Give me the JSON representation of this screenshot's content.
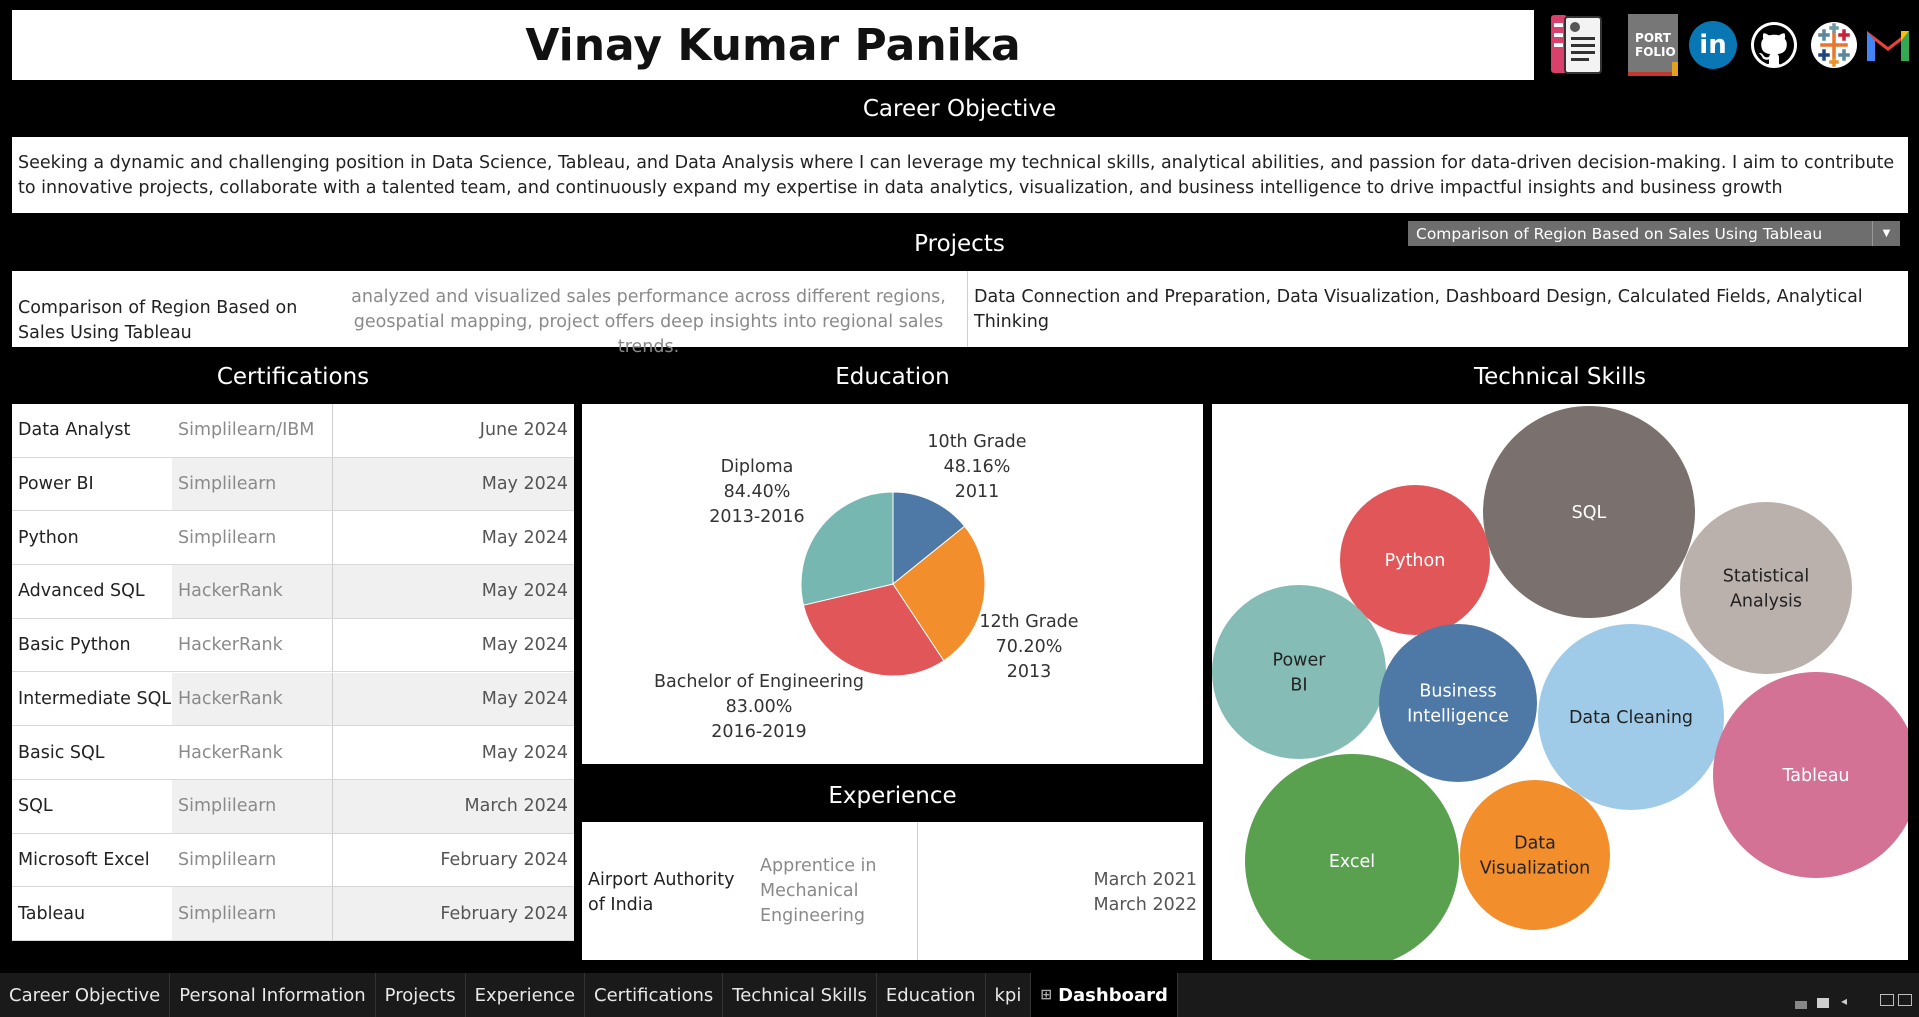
{
  "header": {
    "name": "Vinay Kumar Panika",
    "icons": [
      {
        "name": "resume-icon"
      },
      {
        "name": "portfolio-icon",
        "text": "PORT FOLIO"
      },
      {
        "name": "linkedin-icon",
        "text": "in"
      },
      {
        "name": "github-icon"
      },
      {
        "name": "tableau-icon"
      },
      {
        "name": "gmail-icon"
      }
    ]
  },
  "career": {
    "title": "Career Objective",
    "text": "Seeking a dynamic and challenging position in Data Science, Tableau, and Data Analysis where I can leverage my technical skills, analytical abilities, and passion for data-driven decision-making. I aim to contribute to innovative projects, collaborate with a talented team, and continuously expand my expertise in data analytics, visualization, and business intelligence to drive impactful insights and business growth"
  },
  "projects": {
    "title": "Projects",
    "dropdown_value": "Comparison of Region Based on Sales Using Tableau",
    "name": "Comparison of Region Based on Sales Using Tableau",
    "description": "analyzed and visualized sales performance across different regions, geospatial mapping, project offers deep insights into regional sales trends.",
    "skills": "Data Connection and Preparation, Data Visualization, Dashboard Design, Calculated Fields,  Analytical Thinking"
  },
  "certifications": {
    "title": "Certifications",
    "rows": [
      {
        "name": "Data Analyst",
        "issuer": "Simplilearn/IBM",
        "date": "June 2024"
      },
      {
        "name": "Power BI",
        "issuer": "Simplilearn",
        "date": "May 2024"
      },
      {
        "name": "Python",
        "issuer": "Simplilearn",
        "date": "May 2024"
      },
      {
        "name": "Advanced SQL",
        "issuer": "HackerRank",
        "date": "May 2024"
      },
      {
        "name": "Basic Python",
        "issuer": "HackerRank",
        "date": "May 2024"
      },
      {
        "name": "Intermediate SQL",
        "issuer": "HackerRank",
        "date": "May 2024"
      },
      {
        "name": "Basic SQL",
        "issuer": "HackerRank",
        "date": "May 2024"
      },
      {
        "name": "SQL",
        "issuer": "Simplilearn",
        "date": "March 2024"
      },
      {
        "name": "Microsoft Excel",
        "issuer": "Simplilearn",
        "date": "February 2024"
      },
      {
        "name": "Tableau",
        "issuer": "Simplilearn",
        "date": "February 2024"
      }
    ]
  },
  "education": {
    "title": "Education",
    "slices": [
      {
        "label": "10th Grade",
        "percent": "48.16%",
        "period": "2011",
        "share": 0.142,
        "color": "#4e79a7"
      },
      {
        "label": "12th Grade",
        "percent": "70.20%",
        "period": "2013",
        "share": 0.265,
        "color": "#f28e2b"
      },
      {
        "label": "Bachelor of Engineering",
        "percent": "83.00%",
        "period": "2016-2019",
        "share": 0.306,
        "color": "#e15759"
      },
      {
        "label": "Diploma",
        "percent": "84.40%",
        "period": "2013-2016",
        "share": 0.287,
        "color": "#76b7b2"
      }
    ]
  },
  "experience": {
    "title": "Experience",
    "company": "Airport Authority of India",
    "role": "Apprentice in Mechanical Engineering",
    "start": "March 2021",
    "end": "March 2022"
  },
  "skills": {
    "title": "Technical Skills",
    "items": [
      {
        "label": "SQL",
        "color": "#7a706d",
        "text_color": "#ffffff"
      },
      {
        "label": "Python",
        "color": "#e15759",
        "text_color": "#ffffff"
      },
      {
        "label": "Statistical Analysis",
        "color": "#bab0ac",
        "text_color": "#222222"
      },
      {
        "label": "Power BI",
        "color": "#86bcb6",
        "text_color": "#222222"
      },
      {
        "label": "Business Intelligence",
        "color": "#4e79a7",
        "text_color": "#ffffff"
      },
      {
        "label": "Data Cleaning",
        "color": "#a0cbe8",
        "text_color": "#222222"
      },
      {
        "label": "Tableau",
        "color": "#d37295",
        "text_color": "#ffffff"
      },
      {
        "label": "Excel",
        "color": "#59a14f",
        "text_color": "#ffffff"
      },
      {
        "label": "Data Visualization",
        "color": "#f28e2b",
        "text_color": "#222222"
      }
    ]
  },
  "tabs": [
    {
      "label": "Career Objective",
      "active": false
    },
    {
      "label": "Personal Information",
      "active": false
    },
    {
      "label": "Projects",
      "active": false
    },
    {
      "label": "Experience",
      "active": false
    },
    {
      "label": "Certifications",
      "active": false
    },
    {
      "label": "Technical Skills",
      "active": false
    },
    {
      "label": "Education",
      "active": false
    },
    {
      "label": "kpi",
      "active": false
    },
    {
      "label": "Dashboard",
      "active": true
    }
  ]
}
